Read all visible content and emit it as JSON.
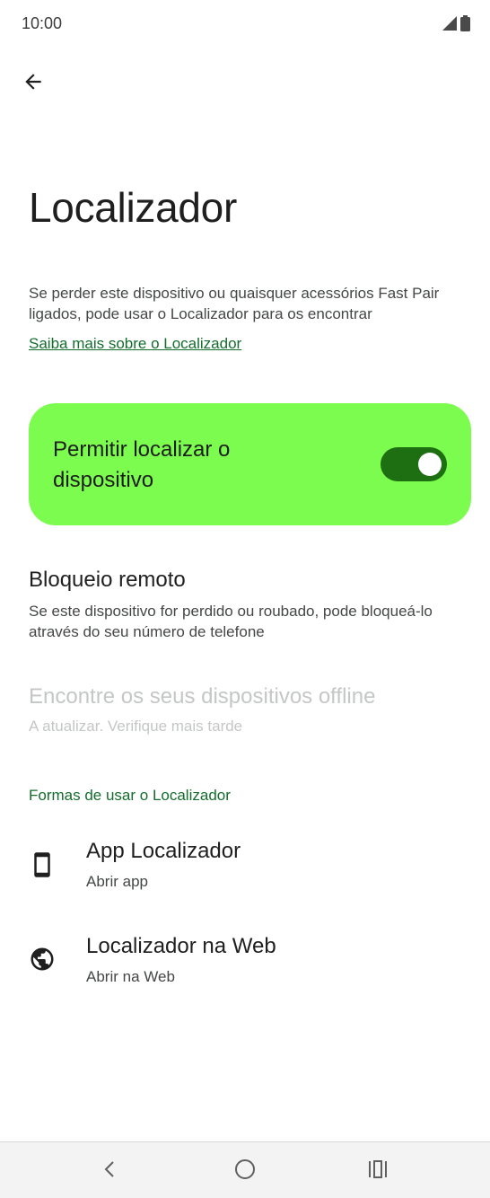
{
  "status_bar": {
    "time": "10:00",
    "icons": [
      "signal-icon",
      "battery-icon"
    ]
  },
  "header": {
    "back_icon": "arrow-back-icon"
  },
  "page": {
    "title": "Localizador",
    "description": "Se perder este dispositivo ou quaisquer acessórios Fast Pair ligados, pode usar o Localizador para os encontrar",
    "learn_more_link": "Saiba mais sobre o Localizador"
  },
  "main_toggle": {
    "label": "Permitir localizar o dispositivo",
    "checked": true,
    "card_color": "#7cfc4e",
    "switch_color": "#1e6e12"
  },
  "settings": {
    "remote_lock": {
      "title": "Bloqueio remoto",
      "summary": "Se este dispositivo for perdido ou roubado, pode bloqueá-lo através do seu número de telefone"
    },
    "offline_devices": {
      "title": "Encontre os seus dispositivos offline",
      "summary": "A atualizar. Verifique mais tarde",
      "enabled": false
    }
  },
  "ways_section": {
    "header": "Formas de usar o Localizador",
    "items": [
      {
        "icon": "smartphone-icon",
        "title": "App Localizador",
        "summary": "Abrir app"
      },
      {
        "icon": "globe-icon",
        "title": "Localizador na Web",
        "summary": "Abrir na Web"
      }
    ]
  },
  "nav_bar": {
    "buttons": [
      "back-nav-icon",
      "home-nav-icon",
      "recents-nav-icon"
    ]
  },
  "colors": {
    "accent_green": "#146c2e",
    "text_primary": "#1f1f1f",
    "text_secondary": "#444746",
    "text_disabled": "#c4c7c5"
  }
}
